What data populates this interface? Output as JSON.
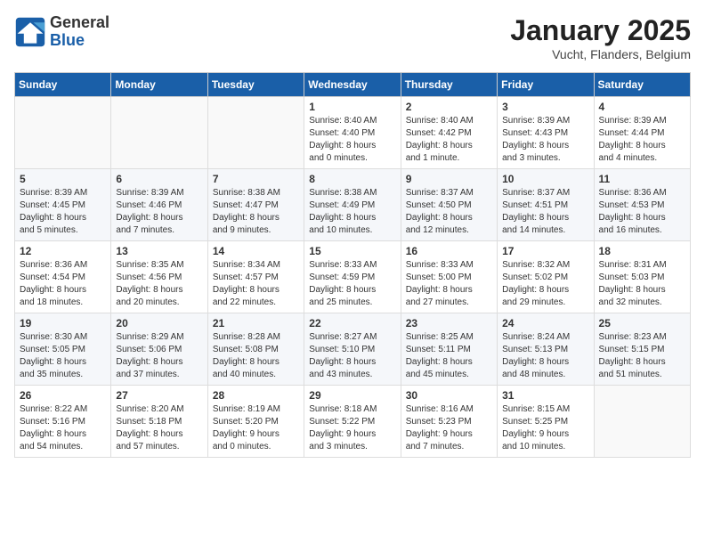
{
  "header": {
    "logo_general": "General",
    "logo_blue": "Blue",
    "month_title": "January 2025",
    "subtitle": "Vucht, Flanders, Belgium"
  },
  "days_of_week": [
    "Sunday",
    "Monday",
    "Tuesday",
    "Wednesday",
    "Thursday",
    "Friday",
    "Saturday"
  ],
  "weeks": [
    [
      {
        "day": "",
        "content": ""
      },
      {
        "day": "",
        "content": ""
      },
      {
        "day": "",
        "content": ""
      },
      {
        "day": "1",
        "content": "Sunrise: 8:40 AM\nSunset: 4:40 PM\nDaylight: 8 hours\nand 0 minutes."
      },
      {
        "day": "2",
        "content": "Sunrise: 8:40 AM\nSunset: 4:42 PM\nDaylight: 8 hours\nand 1 minute."
      },
      {
        "day": "3",
        "content": "Sunrise: 8:39 AM\nSunset: 4:43 PM\nDaylight: 8 hours\nand 3 minutes."
      },
      {
        "day": "4",
        "content": "Sunrise: 8:39 AM\nSunset: 4:44 PM\nDaylight: 8 hours\nand 4 minutes."
      }
    ],
    [
      {
        "day": "5",
        "content": "Sunrise: 8:39 AM\nSunset: 4:45 PM\nDaylight: 8 hours\nand 5 minutes."
      },
      {
        "day": "6",
        "content": "Sunrise: 8:39 AM\nSunset: 4:46 PM\nDaylight: 8 hours\nand 7 minutes."
      },
      {
        "day": "7",
        "content": "Sunrise: 8:38 AM\nSunset: 4:47 PM\nDaylight: 8 hours\nand 9 minutes."
      },
      {
        "day": "8",
        "content": "Sunrise: 8:38 AM\nSunset: 4:49 PM\nDaylight: 8 hours\nand 10 minutes."
      },
      {
        "day": "9",
        "content": "Sunrise: 8:37 AM\nSunset: 4:50 PM\nDaylight: 8 hours\nand 12 minutes."
      },
      {
        "day": "10",
        "content": "Sunrise: 8:37 AM\nSunset: 4:51 PM\nDaylight: 8 hours\nand 14 minutes."
      },
      {
        "day": "11",
        "content": "Sunrise: 8:36 AM\nSunset: 4:53 PM\nDaylight: 8 hours\nand 16 minutes."
      }
    ],
    [
      {
        "day": "12",
        "content": "Sunrise: 8:36 AM\nSunset: 4:54 PM\nDaylight: 8 hours\nand 18 minutes."
      },
      {
        "day": "13",
        "content": "Sunrise: 8:35 AM\nSunset: 4:56 PM\nDaylight: 8 hours\nand 20 minutes."
      },
      {
        "day": "14",
        "content": "Sunrise: 8:34 AM\nSunset: 4:57 PM\nDaylight: 8 hours\nand 22 minutes."
      },
      {
        "day": "15",
        "content": "Sunrise: 8:33 AM\nSunset: 4:59 PM\nDaylight: 8 hours\nand 25 minutes."
      },
      {
        "day": "16",
        "content": "Sunrise: 8:33 AM\nSunset: 5:00 PM\nDaylight: 8 hours\nand 27 minutes."
      },
      {
        "day": "17",
        "content": "Sunrise: 8:32 AM\nSunset: 5:02 PM\nDaylight: 8 hours\nand 29 minutes."
      },
      {
        "day": "18",
        "content": "Sunrise: 8:31 AM\nSunset: 5:03 PM\nDaylight: 8 hours\nand 32 minutes."
      }
    ],
    [
      {
        "day": "19",
        "content": "Sunrise: 8:30 AM\nSunset: 5:05 PM\nDaylight: 8 hours\nand 35 minutes."
      },
      {
        "day": "20",
        "content": "Sunrise: 8:29 AM\nSunset: 5:06 PM\nDaylight: 8 hours\nand 37 minutes."
      },
      {
        "day": "21",
        "content": "Sunrise: 8:28 AM\nSunset: 5:08 PM\nDaylight: 8 hours\nand 40 minutes."
      },
      {
        "day": "22",
        "content": "Sunrise: 8:27 AM\nSunset: 5:10 PM\nDaylight: 8 hours\nand 43 minutes."
      },
      {
        "day": "23",
        "content": "Sunrise: 8:25 AM\nSunset: 5:11 PM\nDaylight: 8 hours\nand 45 minutes."
      },
      {
        "day": "24",
        "content": "Sunrise: 8:24 AM\nSunset: 5:13 PM\nDaylight: 8 hours\nand 48 minutes."
      },
      {
        "day": "25",
        "content": "Sunrise: 8:23 AM\nSunset: 5:15 PM\nDaylight: 8 hours\nand 51 minutes."
      }
    ],
    [
      {
        "day": "26",
        "content": "Sunrise: 8:22 AM\nSunset: 5:16 PM\nDaylight: 8 hours\nand 54 minutes."
      },
      {
        "day": "27",
        "content": "Sunrise: 8:20 AM\nSunset: 5:18 PM\nDaylight: 8 hours\nand 57 minutes."
      },
      {
        "day": "28",
        "content": "Sunrise: 8:19 AM\nSunset: 5:20 PM\nDaylight: 9 hours\nand 0 minutes."
      },
      {
        "day": "29",
        "content": "Sunrise: 8:18 AM\nSunset: 5:22 PM\nDaylight: 9 hours\nand 3 minutes."
      },
      {
        "day": "30",
        "content": "Sunrise: 8:16 AM\nSunset: 5:23 PM\nDaylight: 9 hours\nand 7 minutes."
      },
      {
        "day": "31",
        "content": "Sunrise: 8:15 AM\nSunset: 5:25 PM\nDaylight: 9 hours\nand 10 minutes."
      },
      {
        "day": "",
        "content": ""
      }
    ]
  ]
}
